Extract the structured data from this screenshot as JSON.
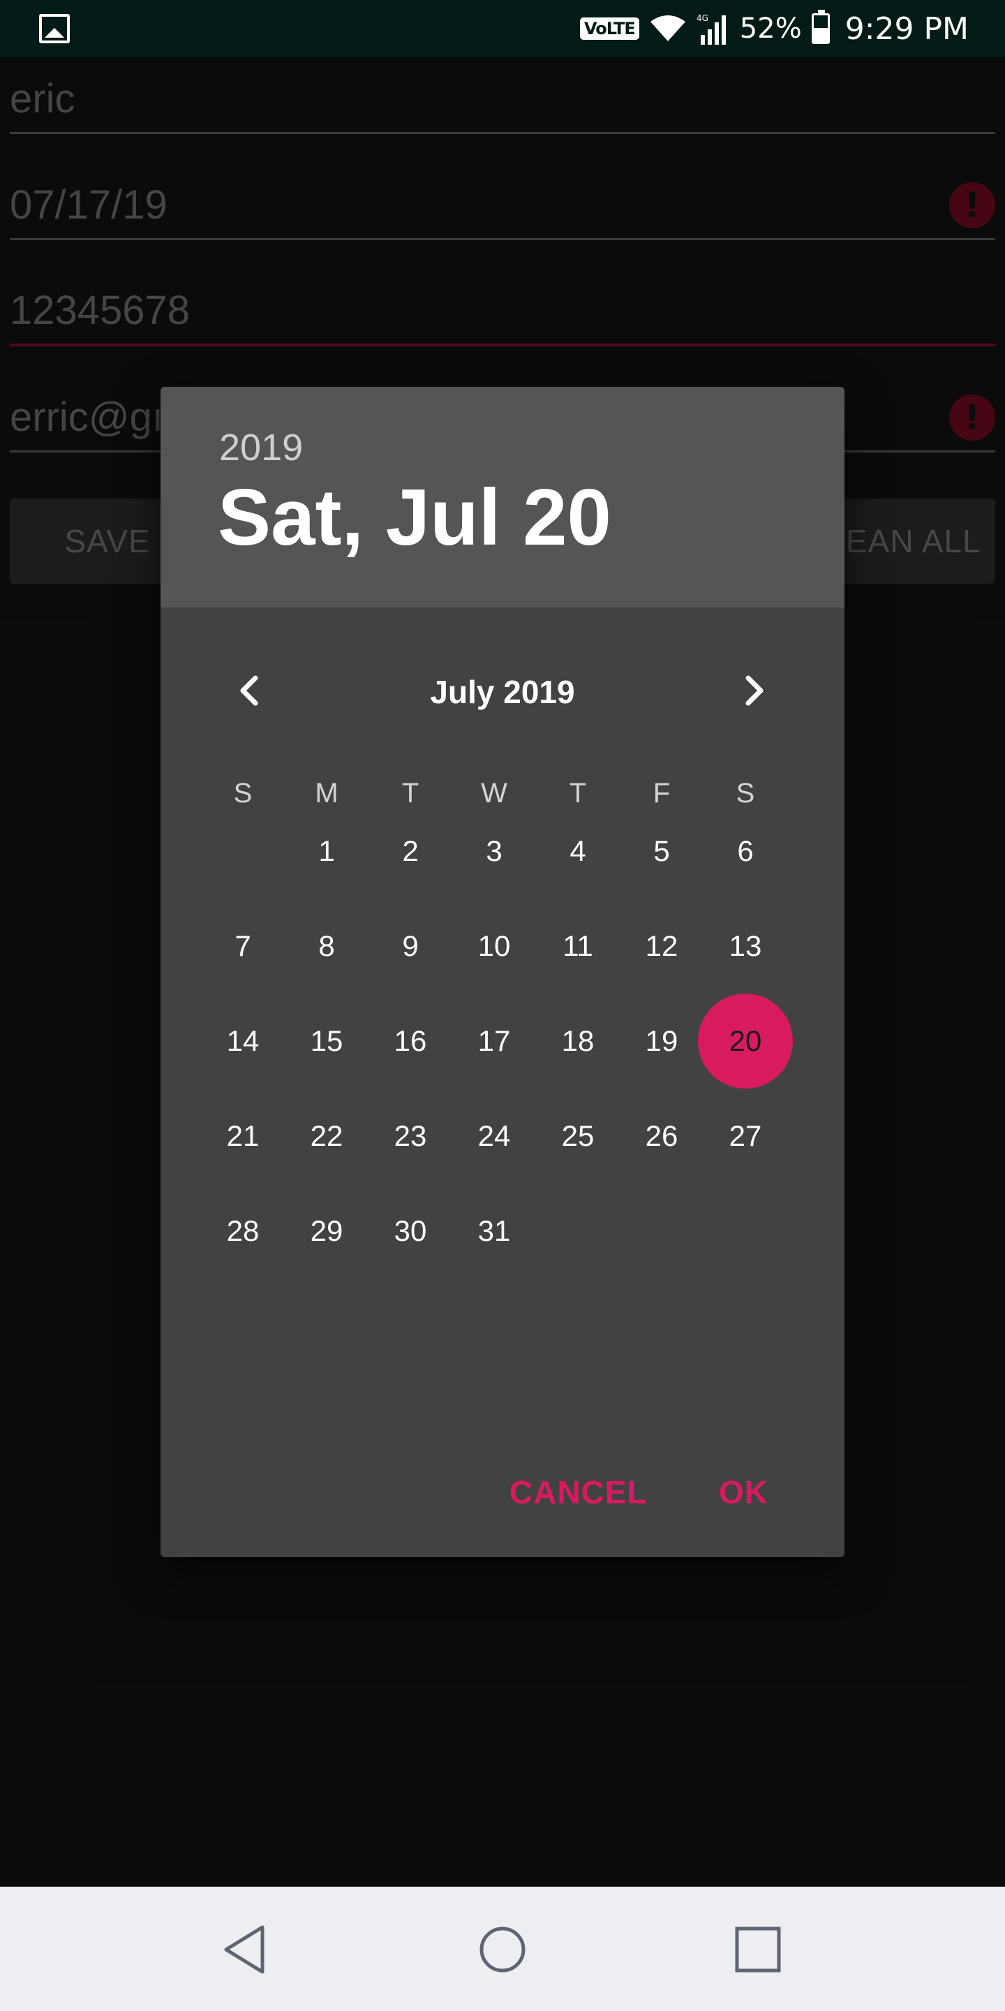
{
  "status_bar": {
    "volte": "VoLTE",
    "network": "4G",
    "battery": "52%",
    "time": "9:29 PM"
  },
  "form": {
    "name_value": "eric",
    "date_value": "07/17/19",
    "phone_value": "12345678",
    "email_value": "erric@gı",
    "save_label": "SAVE",
    "clean_label": "EAN ALL"
  },
  "dialog": {
    "year": "2019",
    "selected_date": "Sat, Jul 20",
    "month_label": "July 2019",
    "weekdays": [
      "S",
      "M",
      "T",
      "W",
      "T",
      "F",
      "S"
    ],
    "first_weekday_offset": 1,
    "days_in_month": 31,
    "selected_day": 20,
    "cancel_label": "CANCEL",
    "ok_label": "OK"
  },
  "colors": {
    "accent": "#d81b60",
    "error": "#6e0a1e"
  }
}
